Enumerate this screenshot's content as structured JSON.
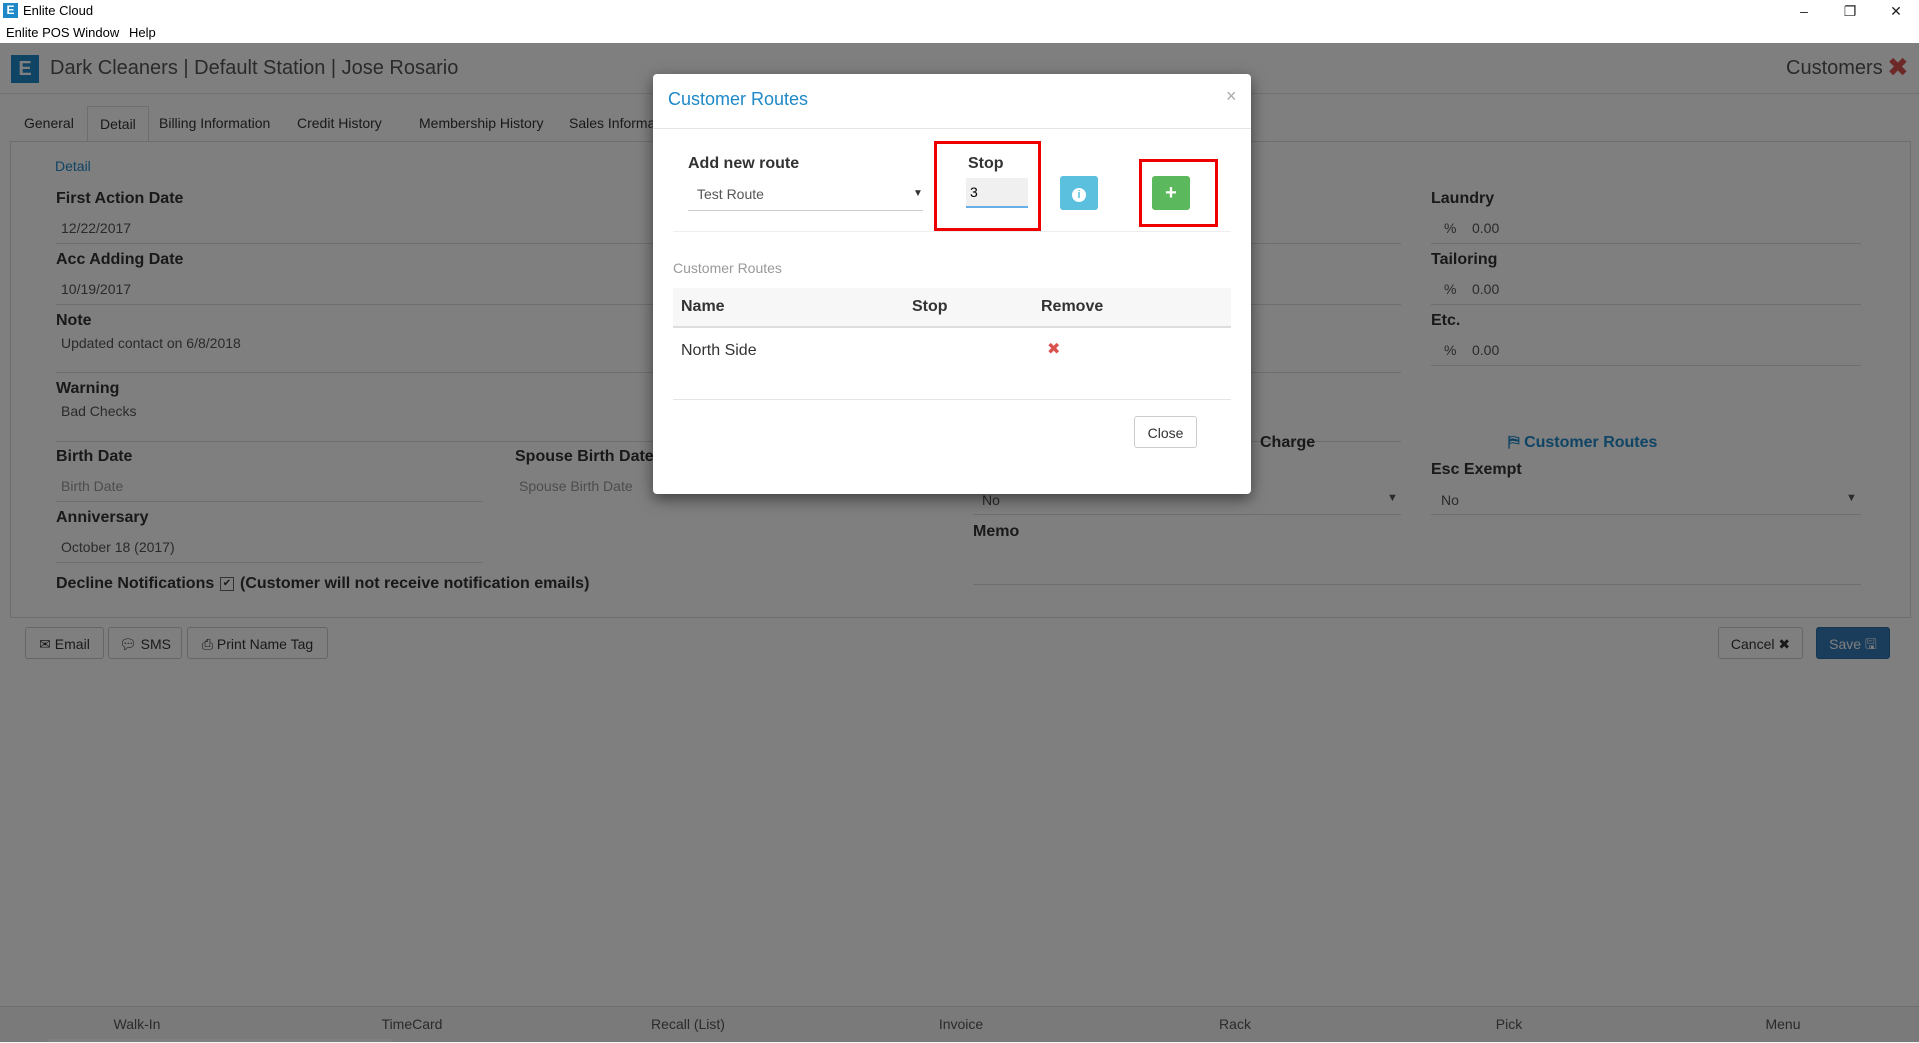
{
  "window": {
    "title": "Enlite Cloud",
    "logo_letter": "E",
    "minimize": "–",
    "restore": "❐",
    "close": "✕",
    "menu": [
      "Enlite POS",
      "Window",
      "Help"
    ]
  },
  "header": {
    "logo_letter": "E",
    "title": "Dark Cleaners | Default Station | Jose Rosario",
    "module": "Customers",
    "close_icon": "✖"
  },
  "tabs": [
    "General",
    "Detail",
    "Billing Information",
    "Credit History",
    "Membership History",
    "Sales Informat"
  ],
  "detail": {
    "section_link": "Detail",
    "first_action_date": {
      "label": "First Action Date",
      "value": "12/22/2017"
    },
    "acc_adding_date": {
      "label": "Acc Adding Date",
      "value": "10/19/2017"
    },
    "note": {
      "label": "Note",
      "value": "Updated contact on 6/8/2018"
    },
    "warning": {
      "label": "Warning",
      "value": "Bad Checks"
    },
    "birth_date": {
      "label": "Birth Date",
      "placeholder": "Birth Date"
    },
    "spouse_birth_date": {
      "label": "Spouse Birth Date",
      "placeholder": "Spouse Birth Date"
    },
    "anniversary": {
      "label": "Anniversary",
      "value": "October 18 (2017)"
    },
    "decline_notifications": {
      "label": "Decline Notifications",
      "note": "(Customer will not receive notification emails)",
      "checked": true
    },
    "laundry": {
      "label": "Laundry",
      "prefix": "%",
      "value": "0.00"
    },
    "tailoring": {
      "label": "Tailoring",
      "prefix": "%",
      "value": "0.00"
    },
    "etc": {
      "label": "Etc.",
      "prefix": "%",
      "value": "0.00"
    },
    "charge": {
      "label": "Charge",
      "value": "No"
    },
    "customer_routes_link": "Customer Routes",
    "esc_exempt": {
      "label": "Esc Exempt",
      "value": "No"
    },
    "memo": {
      "label": "Memo"
    }
  },
  "actions": {
    "email": "Email",
    "sms": "SMS",
    "print_name_tag": "Print Name Tag",
    "cancel": "Cancel",
    "save": "Save"
  },
  "bottom_nav": [
    "Walk-In",
    "TimeCard",
    "Recall (List)",
    "Invoice",
    "Rack",
    "Pick",
    "Menu"
  ],
  "modal": {
    "title": "Customer Routes",
    "close_x": "×",
    "add_new_route_label": "Add new route",
    "route_selected": "Test Route",
    "stop_label": "Stop",
    "stop_value": "3",
    "info_icon": "i",
    "add_icon": "+",
    "routes_section_label": "Customer Routes",
    "table": {
      "columns": [
        "Name",
        "Stop",
        "Remove"
      ],
      "rows": [
        {
          "name": "North Side",
          "stop": "",
          "remove_icon": "✖"
        }
      ]
    },
    "close_button": "Close"
  },
  "colors": {
    "accent": "#1e88c8",
    "danger": "#d9534f",
    "success": "#5cb85c",
    "info": "#5bc0de",
    "highlight": "#e00000"
  }
}
